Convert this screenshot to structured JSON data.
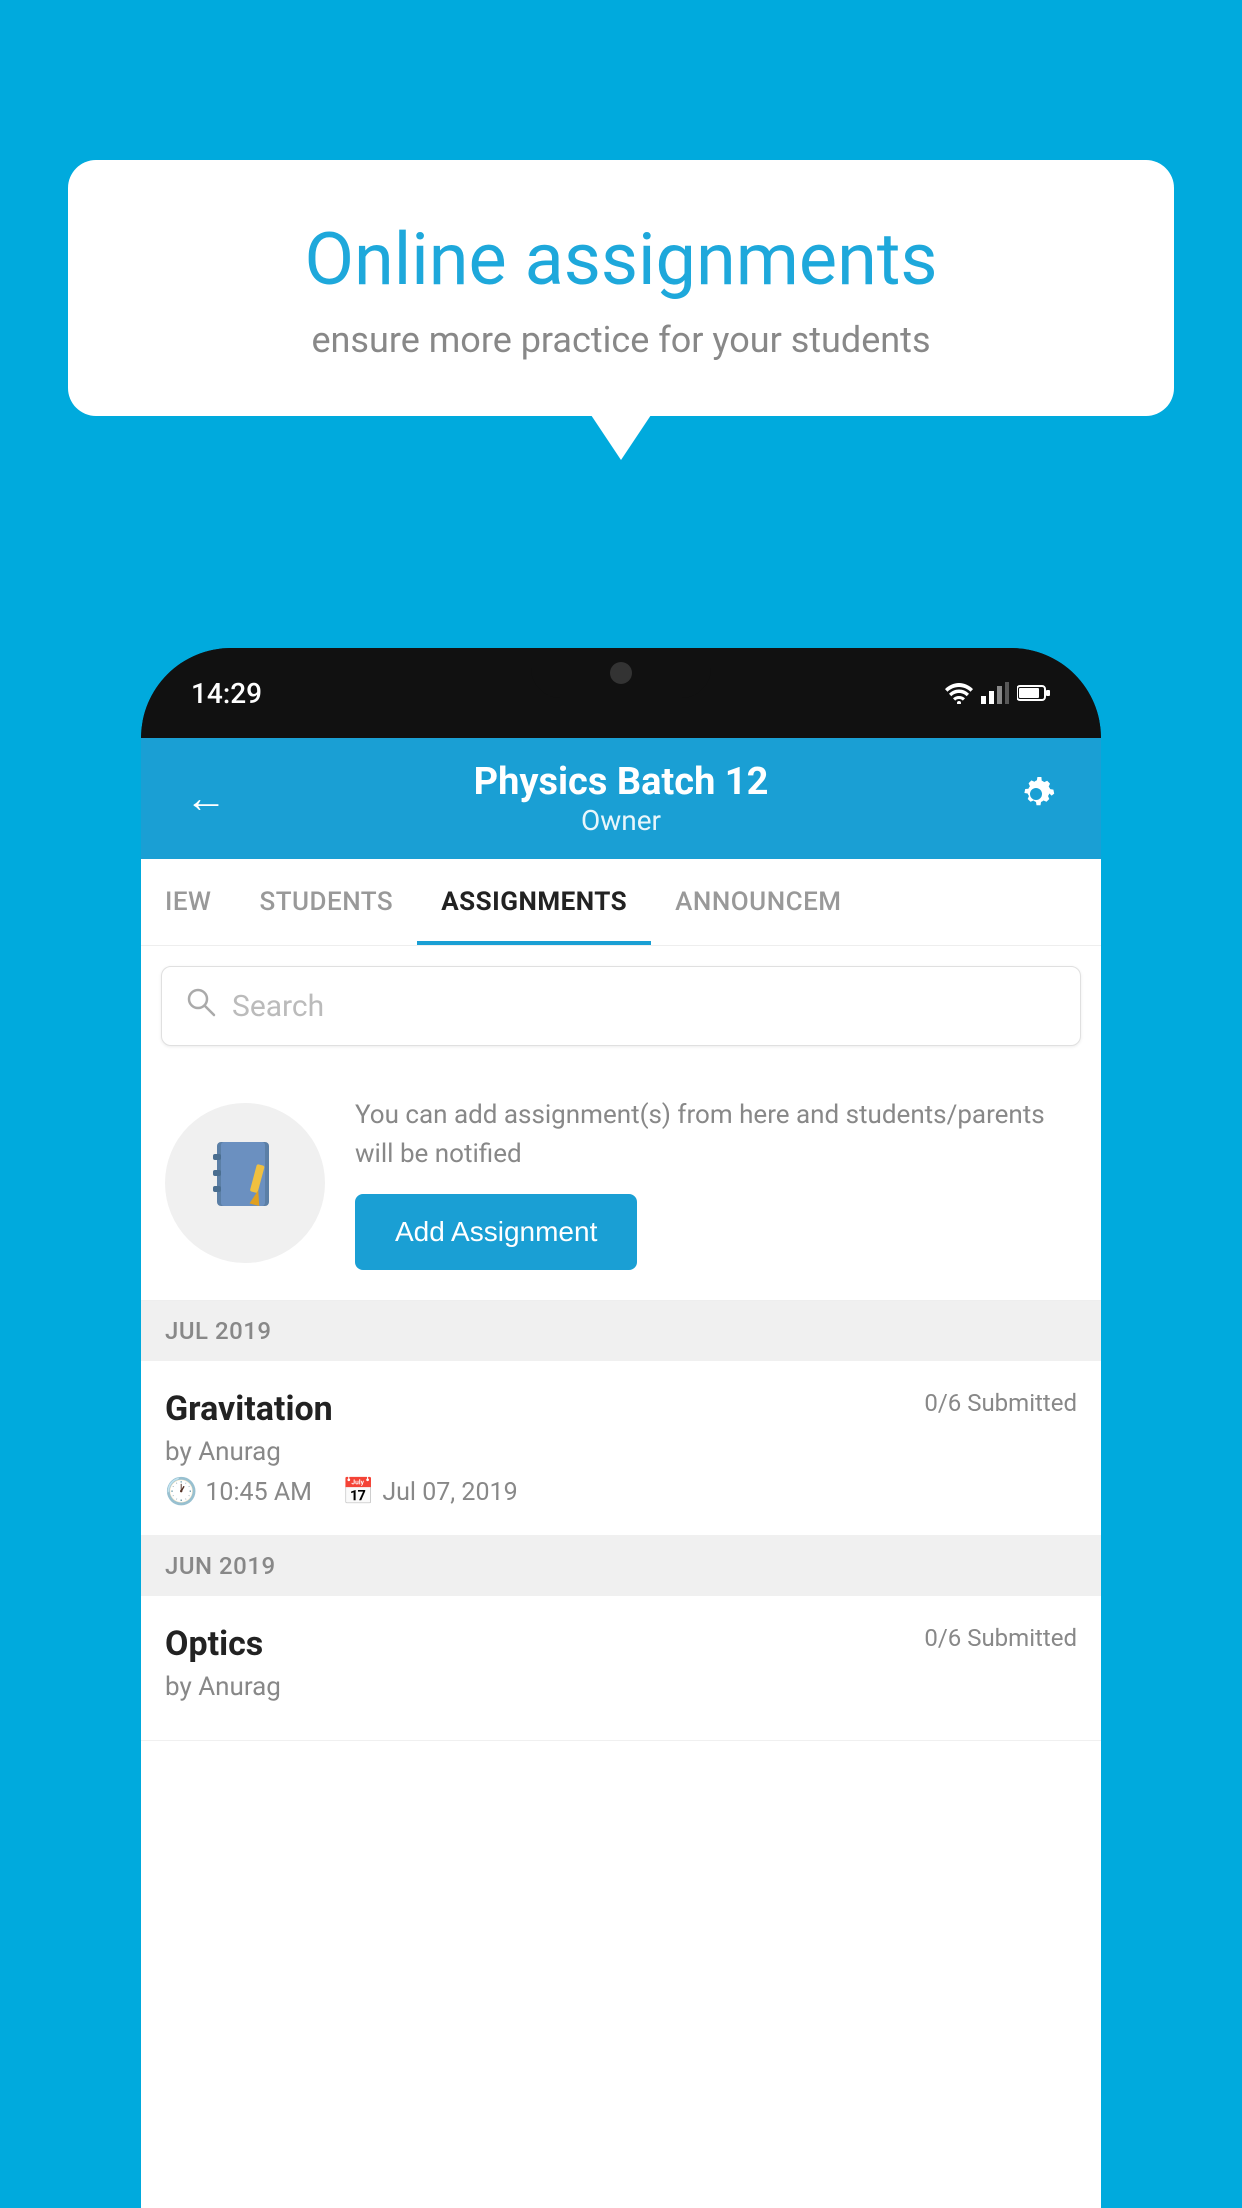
{
  "background_color": "#00AADD",
  "promo": {
    "title": "Online assignments",
    "subtitle": "ensure more practice for your students"
  },
  "status_bar": {
    "time": "14:29"
  },
  "header": {
    "title": "Physics Batch 12",
    "subtitle": "Owner"
  },
  "tabs": [
    {
      "label": "IEW",
      "active": false
    },
    {
      "label": "STUDENTS",
      "active": false
    },
    {
      "label": "ASSIGNMENTS",
      "active": true
    },
    {
      "label": "ANNOUNCEM",
      "active": false
    }
  ],
  "search": {
    "placeholder": "Search"
  },
  "empty_state": {
    "description": "You can add assignment(s) from here and students/parents will be notified",
    "button_label": "Add Assignment"
  },
  "sections": [
    {
      "label": "JUL 2019",
      "assignments": [
        {
          "title": "Gravitation",
          "submitted": "0/6 Submitted",
          "author": "by Anurag",
          "time": "10:45 AM",
          "date": "Jul 07, 2019"
        }
      ]
    },
    {
      "label": "JUN 2019",
      "assignments": [
        {
          "title": "Optics",
          "submitted": "0/6 Submitted",
          "author": "by Anurag",
          "time": "",
          "date": ""
        }
      ]
    }
  ]
}
